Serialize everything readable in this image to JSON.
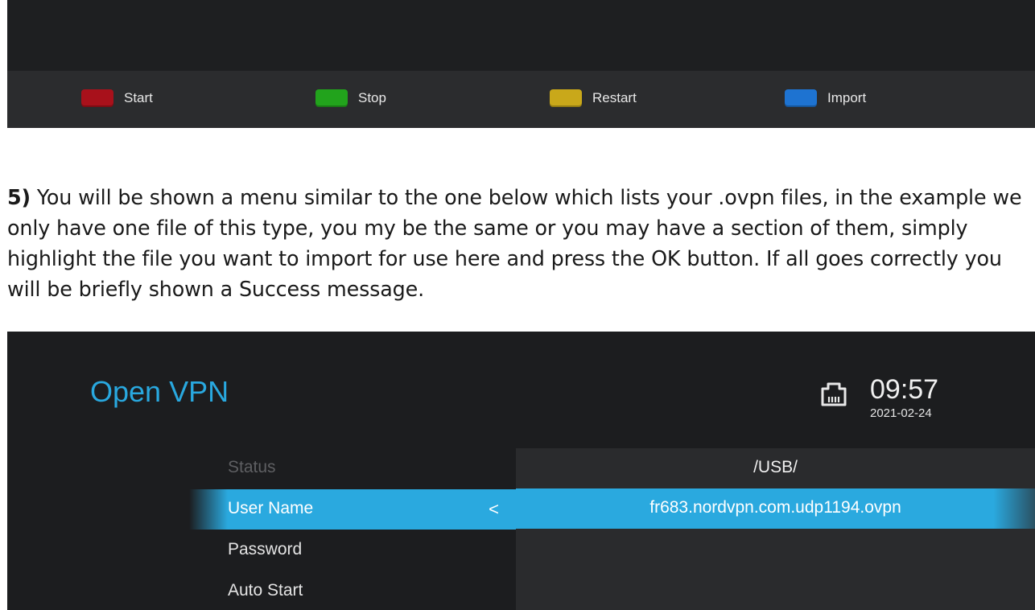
{
  "top_screenshot": {
    "buttons": [
      {
        "label": "Start",
        "color": "#a8111b"
      },
      {
        "label": "Stop",
        "color": "#22a31c"
      },
      {
        "label": "Restart",
        "color": "#c9a81a"
      },
      {
        "label": "Import",
        "color": "#1e73d1"
      }
    ]
  },
  "instructions": {
    "step": "5)",
    "text": " You will be shown a menu similar to the one below which lists your .ovpn files, in the example we only have one file of this type, you my be the same or you may have a section of them, simply highlight the file you want to import for use here and press the OK button. If all goes correctly you will be briefly shown a Success message."
  },
  "vpn_screen": {
    "title": "Open VPN",
    "time": "09:57",
    "date": "2021-02-24",
    "network_icon": "ethernet-icon",
    "accent_color": "#29a8df",
    "menu": [
      {
        "label": "Status",
        "state": "disabled"
      },
      {
        "label": "User Name",
        "state": "selected"
      },
      {
        "label": "Password",
        "state": "normal"
      },
      {
        "label": "Auto Start",
        "state": "normal"
      }
    ],
    "menu_chevron": "<",
    "file_panel": {
      "path": "/USB/",
      "files": [
        "fr683.nordvpn.com.udp1194.ovpn"
      ]
    }
  }
}
